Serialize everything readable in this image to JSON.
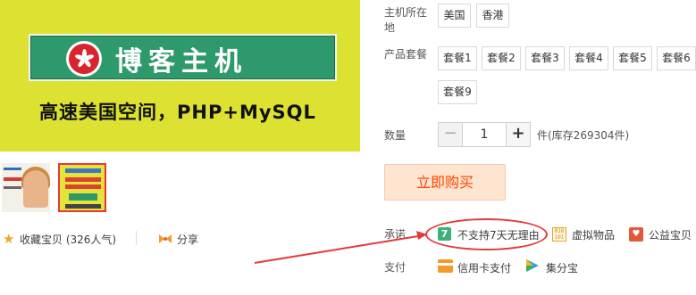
{
  "product_image": {
    "banner_title": "博客主机",
    "tagline": "高速美国空间，PHP+MySQL"
  },
  "thumbnails": [
    {
      "name": "thumb-1"
    },
    {
      "name": "thumb-2",
      "selected": true
    }
  ],
  "actions": {
    "collect_label": "收藏宝贝",
    "collect_count": "(326人气)",
    "share_label": "分享"
  },
  "location": {
    "label": "主机所在地",
    "options": [
      "美国",
      "香港"
    ]
  },
  "package": {
    "label": "产品套餐",
    "options": [
      "套餐1",
      "套餐2",
      "套餐3",
      "套餐4",
      "套餐5",
      "套餐6",
      "套餐9"
    ]
  },
  "quantity": {
    "label": "数量",
    "minus": "−",
    "value": "1",
    "plus": "+",
    "stock": "件(库存269304件)"
  },
  "buy_button": "立即购买",
  "promise": {
    "label": "承诺",
    "items": [
      {
        "icon": "seven-day-icon",
        "badge": "7",
        "text": "不支持7天无理由"
      },
      {
        "icon": "virtual-goods-icon",
        "text": "虚拟物品"
      },
      {
        "icon": "charity-icon",
        "text": "公益宝贝"
      }
    ]
  },
  "payment": {
    "label": "支付",
    "items": [
      {
        "icon": "credit-card-icon",
        "text": "信用卡支付"
      },
      {
        "icon": "jifenbao-icon",
        "text": "集分宝"
      }
    ]
  },
  "colors": {
    "accent": "#ff4400",
    "annotation": "#e23a3a",
    "banner_green": "#2e9a6b",
    "image_yellow": "#dde132"
  }
}
